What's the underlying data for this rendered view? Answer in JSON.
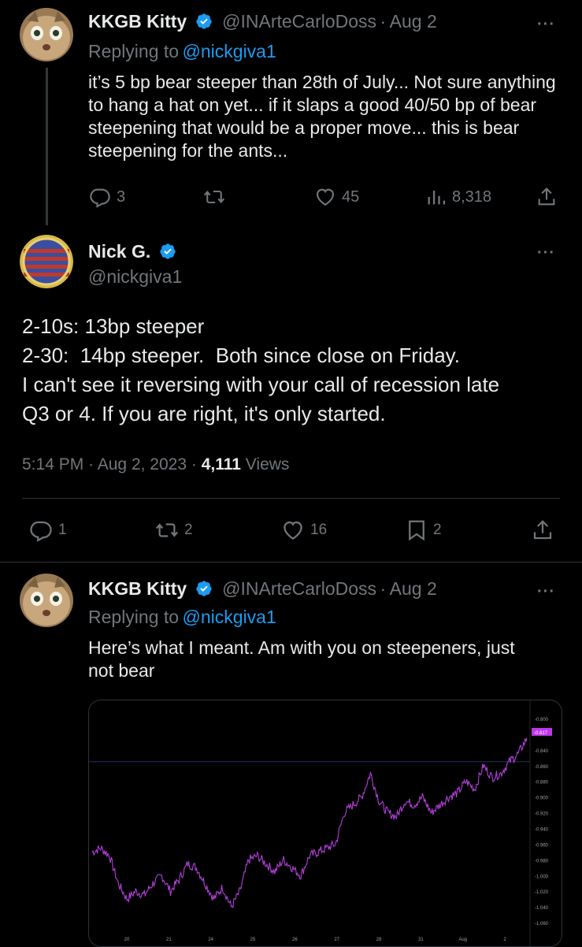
{
  "tweet1": {
    "name": "KKGB Kitty",
    "handle": "@INArteCarloDoss",
    "sep": "·",
    "date": "Aug 2",
    "replying_prefix": "Replying to",
    "replying_handle": "@nickgiva1",
    "text": "it’s 5 bp bear steeper than 28th of July... Not sure anything to hang a hat on yet... if it slaps a good 40/50 bp of bear steepening that would be a proper move... this is bear steepening for the ants...",
    "replies": "3",
    "likes": "45",
    "views": "8,318",
    "more": "···"
  },
  "tweet2": {
    "name": "Nick G.",
    "handle": "@nickgiva1",
    "lines": [
      "2-10s: 13bp steeper",
      "2-30:  14bp steeper.  Both since close on Friday.",
      "I can't see it reversing with your call of recession late",
      "Q3 or 4. If you are right, it's only started."
    ],
    "time": "5:14 PM",
    "sep1": "·",
    "date": "Aug 2, 2023",
    "sep2": "·",
    "view_count": "4,111",
    "views_label": "Views",
    "replies": "1",
    "retweets": "2",
    "likes": "16",
    "bookmarks": "2",
    "more": "···"
  },
  "tweet3": {
    "name": "KKGB Kitty",
    "handle": "@INArteCarloDoss",
    "sep": "·",
    "date": "Aug 2",
    "replying_prefix": "Replying to",
    "replying_handle": "@nickgiva1",
    "text_line1": "Here’s what I meant. Am with you on steepeners, just",
    "text_line2": "not bear",
    "more": "···"
  },
  "icons": {
    "reply": "reply-icon",
    "retweet": "retweet-icon",
    "like": "heart-icon",
    "views": "views-icon",
    "share": "share-icon",
    "bookmark": "bookmark-icon",
    "verified": "verified-badge-icon"
  },
  "colors": {
    "background": "#000000",
    "text": "#e7e9ea",
    "muted": "#71767b",
    "link": "#1d9bf0",
    "chart_line": "#b13fd8",
    "last_price": "#c036e8"
  },
  "chart_data": {
    "type": "line",
    "y_ticks": [
      "-0.800",
      "-0.840",
      "-0.860",
      "-0.880",
      "-0.900",
      "-0.920",
      "-0.940",
      "-0.960",
      "-0.980",
      "-1.000",
      "-1.020",
      "-1.040",
      "-1.060"
    ],
    "x_ticks": [
      "20",
      "21",
      "24",
      "25",
      "26",
      "27",
      "28",
      "31",
      "Aug",
      "2"
    ],
    "ylim": [
      -1.07,
      -0.795
    ],
    "last_price_label": "-0.817",
    "reference_level": -0.855,
    "series": [
      {
        "x": [
          0,
          0.02,
          0.04,
          0.06,
          0.08,
          0.1,
          0.12,
          0.14,
          0.16,
          0.18,
          0.2,
          0.22,
          0.24,
          0.26,
          0.28,
          0.3,
          0.32,
          0.34,
          0.36,
          0.38,
          0.4,
          0.42,
          0.44,
          0.46,
          0.48,
          0.5,
          0.52,
          0.54,
          0.56,
          0.58,
          0.6,
          0.62,
          0.64,
          0.66,
          0.68,
          0.7,
          0.72,
          0.74,
          0.76,
          0.78,
          0.8,
          0.82,
          0.84,
          0.86,
          0.88,
          0.9,
          0.92,
          0.94,
          0.96,
          0.98,
          1.0
        ],
        "values": [
          -0.97,
          -0.965,
          -0.975,
          -1.01,
          -1.03,
          -1.02,
          -1.025,
          -1.01,
          -1.0,
          -1.02,
          -1.005,
          -0.985,
          -0.99,
          -1.01,
          -1.03,
          -1.015,
          -1.04,
          -1.02,
          -0.98,
          -0.975,
          -0.985,
          -0.995,
          -0.98,
          -0.99,
          -1.0,
          -0.975,
          -0.97,
          -0.965,
          -0.96,
          -0.92,
          -0.91,
          -0.9,
          -0.87,
          -0.905,
          -0.92,
          -0.925,
          -0.905,
          -0.91,
          -0.9,
          -0.92,
          -0.91,
          -0.9,
          -0.895,
          -0.88,
          -0.89,
          -0.86,
          -0.875,
          -0.87,
          -0.855,
          -0.845,
          -0.825
        ]
      }
    ]
  }
}
